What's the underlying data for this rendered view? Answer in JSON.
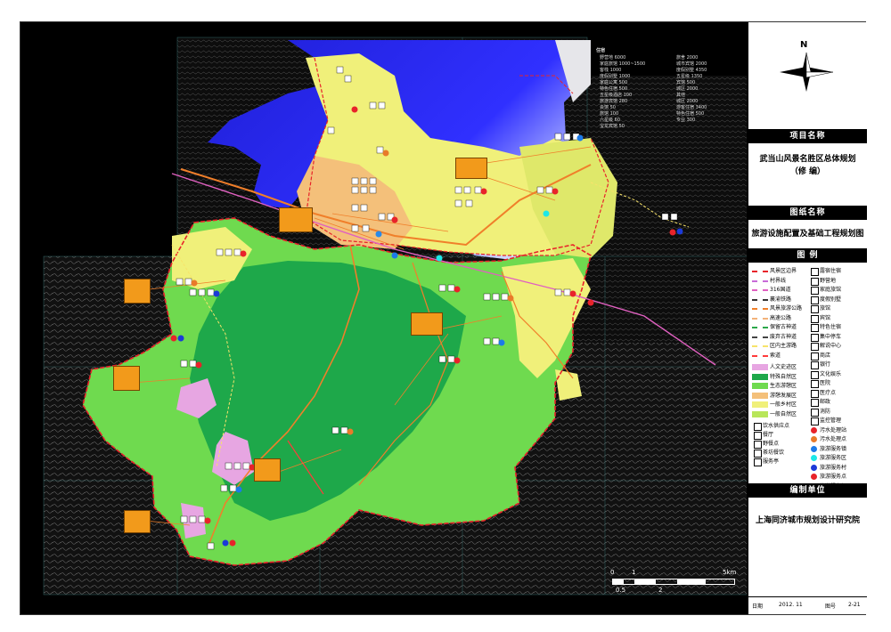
{
  "title_block": {
    "project_name_header": "项目名称",
    "project_name_line1": "武当山风景名胜区总体规划",
    "project_name_line2": "（修  编）",
    "drawing_name_header": "图纸名称",
    "drawing_name": "旅游设施配置及基础工程规划图",
    "legend_header": "图   例",
    "compiler_header": "编制单位",
    "compiler": "上海同济城市规划设计研究院",
    "date_label": "日期",
    "date_value": "2012. 11",
    "drawing_no_label": "图号",
    "drawing_no": "2-21",
    "north_label": "N"
  },
  "legend": {
    "lines": [
      {
        "label": "风景区边界",
        "color": "#e8232a"
      },
      {
        "label": "村界线",
        "color": "#c86bd8"
      },
      {
        "label": "316国道",
        "color": "#e060c0"
      },
      {
        "label": "襄渝铁路",
        "color": "#333333"
      },
      {
        "label": "风景旅游公路",
        "color": "#f07f2a"
      },
      {
        "label": "高速公路",
        "color": "#f2b27a"
      },
      {
        "label": "保留古神道",
        "color": "#2ba84a"
      },
      {
        "label": "废弃古神道",
        "color": "#444444"
      },
      {
        "label": "区内主游路",
        "color": "#f7e36a"
      },
      {
        "label": "索道",
        "color": "#ff3b3b"
      }
    ],
    "zones": [
      {
        "label": "人文史迹区",
        "color": "#e7a6e2"
      },
      {
        "label": "特殊自然区",
        "color": "#1ea84a"
      },
      {
        "label": "生态游憩区",
        "color": "#6fda4f"
      },
      {
        "label": "游憩发展区",
        "color": "#f4c07a"
      },
      {
        "label": "一般乡村区",
        "color": "#f0f07a"
      },
      {
        "label": "一般自然区",
        "color": "#b8e65a"
      }
    ],
    "facilities_left": [
      {
        "label": "饮水供应点",
        "icon": "water-icon"
      },
      {
        "label": "餐厅",
        "icon": "restaurant-icon"
      },
      {
        "label": "野餐点",
        "icon": "picnic-icon"
      },
      {
        "label": "茶坊餐饮",
        "icon": "teahouse-icon"
      },
      {
        "label": "服务亭",
        "icon": "kiosk-icon"
      }
    ],
    "facilities_right": [
      {
        "label": "露宿住宿",
        "icon": "camping-icon"
      },
      {
        "label": "野营地",
        "icon": "tent-icon"
      },
      {
        "label": "家庭旅馆",
        "icon": "family-inn-icon"
      },
      {
        "label": "度假别墅",
        "icon": "villa-icon"
      },
      {
        "label": "旅馆",
        "icon": "hotel-icon"
      },
      {
        "label": "宾馆",
        "icon": "guesthouse-icon"
      },
      {
        "label": "特色住宿",
        "icon": "special-lodging-icon"
      },
      {
        "label": "集中停车",
        "icon": "parking-icon"
      },
      {
        "label": "解说中心",
        "icon": "interpretation-icon"
      },
      {
        "label": "商店",
        "icon": "shop-icon"
      },
      {
        "label": "银行",
        "icon": "bank-icon"
      },
      {
        "label": "文化娱乐",
        "icon": "entertainment-icon"
      },
      {
        "label": "医院",
        "icon": "hospital-icon"
      },
      {
        "label": "医疗点",
        "icon": "clinic-icon"
      },
      {
        "label": "邮政",
        "icon": "post-icon"
      },
      {
        "label": "消防",
        "icon": "fire-icon"
      },
      {
        "label": "监控管理",
        "icon": "monitor-icon"
      },
      {
        "label": "污水处理站",
        "icon": "sewage-station-icon"
      },
      {
        "label": "污水处理点",
        "icon": "sewage-point-icon"
      },
      {
        "label": "旅游服务镇",
        "icon": "service-town-icon"
      },
      {
        "label": "旅游服务区",
        "icon": "service-area-icon"
      },
      {
        "label": "旅游服务村",
        "icon": "service-village-icon"
      },
      {
        "label": "旅游服务点",
        "icon": "service-point-icon"
      },
      {
        "label": "旅游服务部",
        "icon": "service-dept-icon"
      }
    ]
  },
  "stats": {
    "header": "住宿",
    "col1": [
      "野营地  6000",
      "家庭旅馆  1000~1500",
      "客栈  1000",
      "度假别墅  1000",
      "家庭公寓  500",
      "特色住宿  500",
      "五星级酒店  100",
      "旅游宾馆  280",
      "会馆  50",
      "旅馆  100",
      "六星级  60",
      "宝龙宾馆  50"
    ],
    "col2": [
      "旅舍  2000",
      "城市宾馆  2000",
      "度假别墅  4350",
      "五星级  1350",
      "宾馆  500",
      "城区  2000",
      "其他",
      "城区  2000",
      "游客住宿  3400",
      "特色住宿  500",
      "专业  300"
    ]
  },
  "scale": {
    "labels_top": [
      "0",
      "1",
      "5km"
    ],
    "labels_bottom": [
      "0.5",
      "2"
    ]
  }
}
